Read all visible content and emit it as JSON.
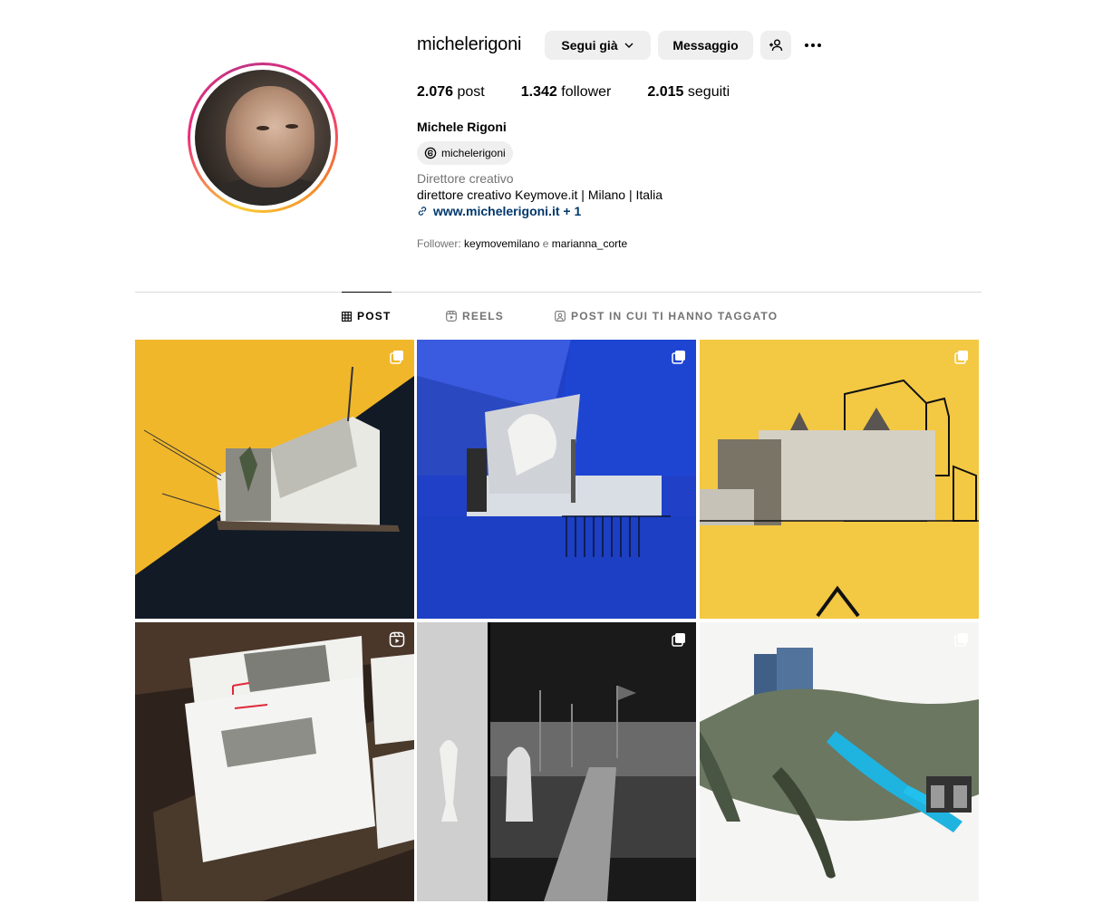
{
  "profile": {
    "username": "michelerigoni",
    "follow_label": "Segui già",
    "message_label": "Messaggio",
    "stats": {
      "posts_count": "2.076",
      "posts_label": "post",
      "followers_count": "1.342",
      "followers_label": "follower",
      "following_count": "2.015",
      "following_label": "seguiti"
    },
    "full_name": "Michele Rigoni",
    "threads_handle": "michelerigoni",
    "category": "Direttore creativo",
    "bio": "direttore creativo Keymove.it | Milano | Italia",
    "link": "www.michelerigoni.it + 1",
    "followed_by_prefix": "Follower:",
    "followed_by_user1": "keymovemilano",
    "followed_by_and": "e",
    "followed_by_user2": "marianna_corte"
  },
  "tabs": [
    {
      "label": "POST",
      "active": true
    },
    {
      "label": "REELS",
      "active": false
    },
    {
      "label": "POST IN CUI TI HANNO TAGGATO",
      "active": false
    }
  ],
  "grid": [
    {
      "type": "carousel",
      "icon": "carousel-icon"
    },
    {
      "type": "carousel",
      "icon": "carousel-icon"
    },
    {
      "type": "carousel",
      "icon": "carousel-icon"
    },
    {
      "type": "reel",
      "icon": "reel-icon"
    },
    {
      "type": "carousel",
      "icon": "carousel-icon"
    },
    {
      "type": "carousel",
      "icon": "carousel-icon"
    }
  ],
  "colors": {
    "ring_start": "#f9ce34",
    "ring_mid": "#ee2a7b",
    "ring_end": "#c13584",
    "link": "#00376b",
    "button_bg": "#efefef",
    "muted_text": "#737373"
  }
}
